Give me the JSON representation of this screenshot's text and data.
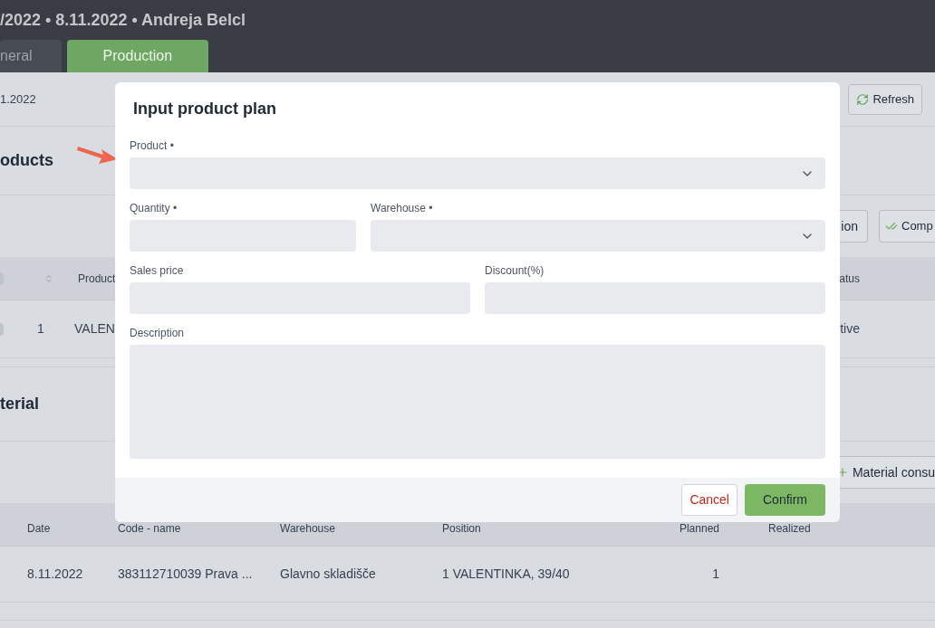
{
  "header": {
    "title": "/2022 • 8.11.2022 • Andreja Belcl"
  },
  "tabs": [
    {
      "label": "neral",
      "selected": false
    },
    {
      "label": "Production",
      "selected": true
    }
  ],
  "toolbar": {
    "date": "1.2022",
    "refresh": "Refresh"
  },
  "products": {
    "heading": "oducts",
    "actions": [
      {
        "label": "ion",
        "kind": "plain"
      },
      {
        "label": "Comp",
        "kind": "check"
      }
    ],
    "table": {
      "header": {
        "checked": false,
        "product": "Product",
        "status": "atus"
      },
      "rows": [
        {
          "checked": false,
          "index": "1",
          "product": "VALEN",
          "status": "tive"
        }
      ]
    }
  },
  "material": {
    "heading": "terial",
    "action": "Material consu",
    "table": {
      "columns": [
        "Date",
        "Code - name",
        "Warehouse",
        "Position",
        "Planned",
        "Realized"
      ],
      "rows": [
        [
          "8.11.2022",
          "383112710039 Prava ...",
          "Glavno skladišče",
          "1 VALENTINKA, 39/40",
          "1"
        ]
      ]
    }
  },
  "modal": {
    "title": "Input product plan",
    "rows": [
      [
        {
          "label": "Product •",
          "kind": "select"
        }
      ],
      [
        {
          "label": "Quantity •",
          "kind": "text"
        },
        {
          "label": "Warehouse •",
          "kind": "select"
        }
      ],
      [
        {
          "label": "Sales price",
          "kind": "text"
        },
        {
          "label": "Discount(%)",
          "kind": "text"
        }
      ],
      [
        {
          "label": "Description",
          "kind": "textarea"
        }
      ]
    ],
    "buttons": [
      {
        "label": "Cancel",
        "kind": "secondary"
      },
      {
        "label": "Confirm",
        "kind": "primary"
      }
    ]
  }
}
